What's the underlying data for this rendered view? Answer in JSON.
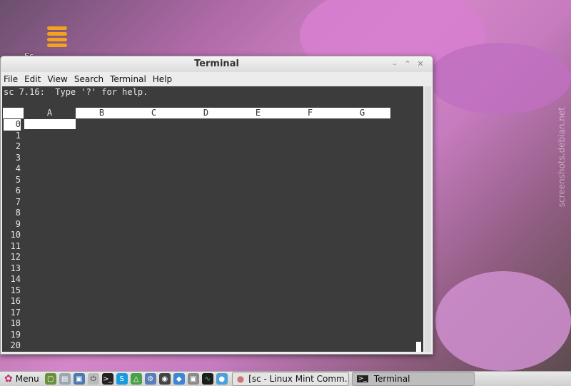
{
  "desktop": {
    "icon_label": "Sc",
    "watermark": "screenshots.debian.net"
  },
  "window": {
    "title": "Terminal"
  },
  "menubar": {
    "items": [
      "File",
      "Edit",
      "View",
      "Search",
      "Terminal",
      "Help"
    ]
  },
  "terminal": {
    "help_line": "sc 7.16:  Type '?' for help.",
    "columns": [
      "A",
      "B",
      "C",
      "D",
      "E",
      "F",
      "G"
    ],
    "selected_column": "A",
    "rows": [
      "0",
      "1",
      "2",
      "3",
      "4",
      "5",
      "6",
      "7",
      "8",
      "9",
      "10",
      "11",
      "12",
      "13",
      "14",
      "15",
      "16",
      "17",
      "18",
      "19",
      "20"
    ],
    "selected_row": "0"
  },
  "taskbar": {
    "menu_label": "Menu",
    "tasks": [
      {
        "label": "[sc - Linux Mint Comm...",
        "active": false
      },
      {
        "label": "Terminal",
        "active": true
      }
    ]
  },
  "colors": {
    "terminal_bg": "#3c3c3c",
    "accent": "#f3a21d"
  }
}
